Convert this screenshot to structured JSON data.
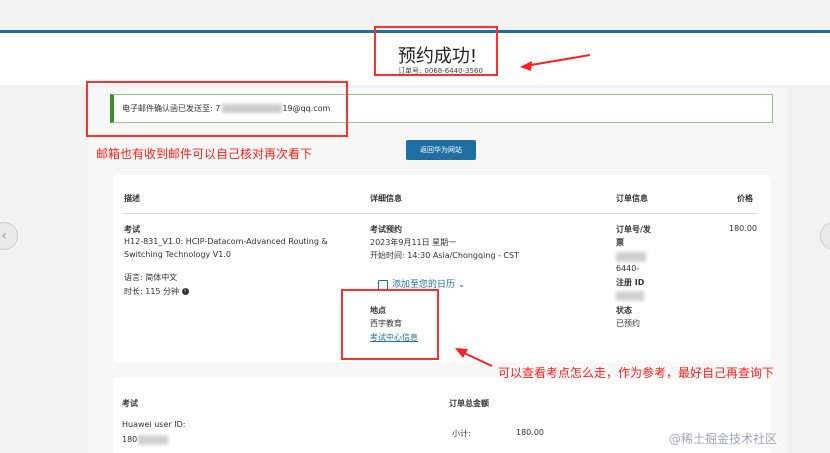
{
  "header": {
    "title": "预约成功!",
    "order_label": "订单号:",
    "order_number": "0068-6440-3560"
  },
  "email_notice": {
    "label": "电子邮件确认函已发送至:",
    "prefix": "7",
    "suffix": "19@qq.com"
  },
  "back_button": "返回华为网站",
  "table": {
    "headers": [
      "描述",
      "详细信息",
      "订单信息",
      "价格"
    ],
    "exam_label": "考试",
    "exam_name_1": "H12-831_V1.0: HCIP-Datacom-Advanced Routing &",
    "exam_name_2": "Switching Technology V1.0",
    "language": "语言: 简体中文",
    "duration": "时长: 115 分钟",
    "booking_label": "考试预约",
    "booking_date": "2023年9月11日 星期一",
    "start_time": "开始时间: 14:30 Asia/Chongqing - CST",
    "add_calendar": "添加至您的日历",
    "location_label": "地点",
    "location_name": "西宇教育",
    "test_center_link": "考试中心信息",
    "order_invoice_label_1": "订单号/发",
    "order_invoice_label_2": "票",
    "order_partial": "6440-",
    "registration_label": "注册 ID",
    "status_label": "状态",
    "status_value": "已预约",
    "price": "180.00"
  },
  "summary": {
    "exam_label": "考试",
    "order_total_label": "订单总金额",
    "user_id_label": "Huawei user ID:",
    "user_id_prefix": "180",
    "subtotal_label": "小计:",
    "subtotal_value": "180.00"
  },
  "annotations": {
    "email_note": "邮箱也有收到邮件可以自己核对再次看下",
    "location_note": "可以查看考点怎么走，作为参考，最好自己再查询下"
  },
  "watermark": "@稀土掘金技术社区",
  "nav": {
    "prev": "‹",
    "next": "›"
  }
}
